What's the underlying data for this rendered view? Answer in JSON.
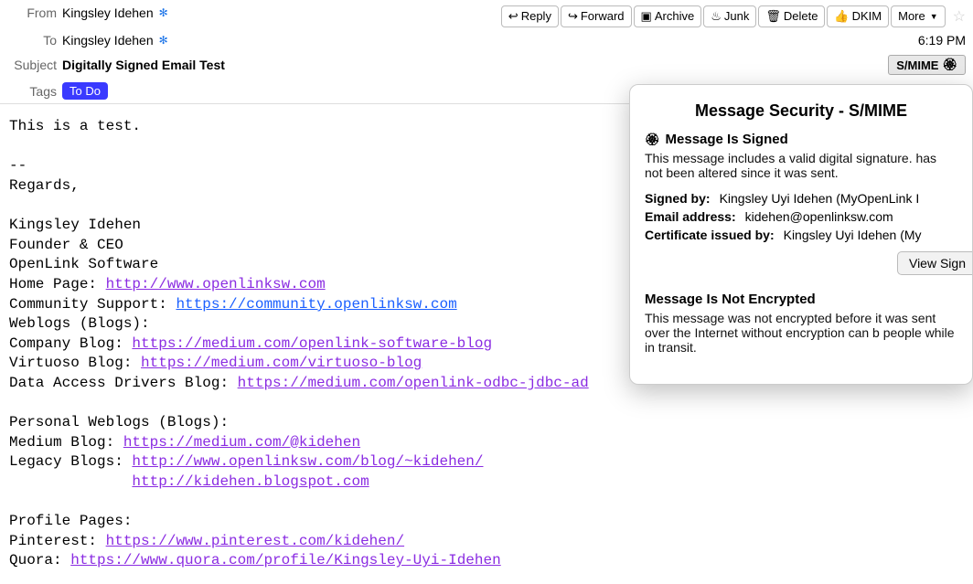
{
  "header": {
    "labels": {
      "from": "From",
      "to": "To",
      "subject": "Subject",
      "tags": "Tags"
    },
    "from": "Kingsley Idehen",
    "to": "Kingsley Idehen",
    "subject": "Digitally Signed Email Test",
    "tag": "To Do",
    "time": "6:19 PM",
    "smime_label": "S/MIME"
  },
  "toolbar": {
    "reply": "Reply",
    "forward": "Forward",
    "archive": "Archive",
    "junk": "Junk",
    "delete": "Delete",
    "dkim": "DKIM",
    "more": "More"
  },
  "body": {
    "line1": "This is a test.",
    "dashes": "--",
    "regards": "Regards,",
    "name": "Kingsley Idehen",
    "title": "Founder & CEO",
    "company": "OpenLink Software",
    "homepage_label": "Home Page: ",
    "homepage_url": "http://www.openlinksw.com",
    "community_label": "Community Support: ",
    "community_url": "https://community.openlinksw.com",
    "weblogs_label": "Weblogs (Blogs):",
    "company_blog_label": "Company Blog: ",
    "company_blog_url": "https://medium.com/openlink-software-blog",
    "virtuoso_label": "Virtuoso Blog: ",
    "virtuoso_url": "https://medium.com/virtuoso-blog",
    "drivers_label": "Data Access Drivers Blog: ",
    "drivers_url": "https://medium.com/openlink-odbc-jdbc-ad",
    "personal_label": "Personal Weblogs (Blogs):",
    "medium_label": "Medium Blog: ",
    "medium_url": "https://medium.com/@kidehen",
    "legacy_label": "Legacy Blogs: ",
    "legacy_url1": "http://www.openlinksw.com/blog/~kidehen/",
    "legacy_url2": "http://kidehen.blogspot.com",
    "legacy_indent": "              ",
    "profile_label": "Profile Pages:",
    "pinterest_label": "Pinterest: ",
    "pinterest_url": "https://www.pinterest.com/kidehen/",
    "quora_label": "Quora: ",
    "quora_url": "https://www.quora.com/profile/Kingsley-Uyi-Idehen"
  },
  "popover": {
    "title": "Message Security - S/MIME",
    "signed_heading": "Message Is Signed",
    "signed_desc": "This message includes a valid digital signature. has not been altered since it was sent.",
    "signed_by_label": "Signed by:",
    "signed_by_value": "Kingsley Uyi Idehen (MyOpenLink I",
    "email_label": "Email address:",
    "email_value": "kidehen@openlinksw.com",
    "cert_label": "Certificate issued by:",
    "cert_value": "Kingsley Uyi Idehen (My",
    "view_button": "View Sign",
    "notenc_heading": "Message Is Not Encrypted",
    "notenc_desc": "This message was not encrypted before it was sent over the Internet without encryption can b people while in transit."
  }
}
